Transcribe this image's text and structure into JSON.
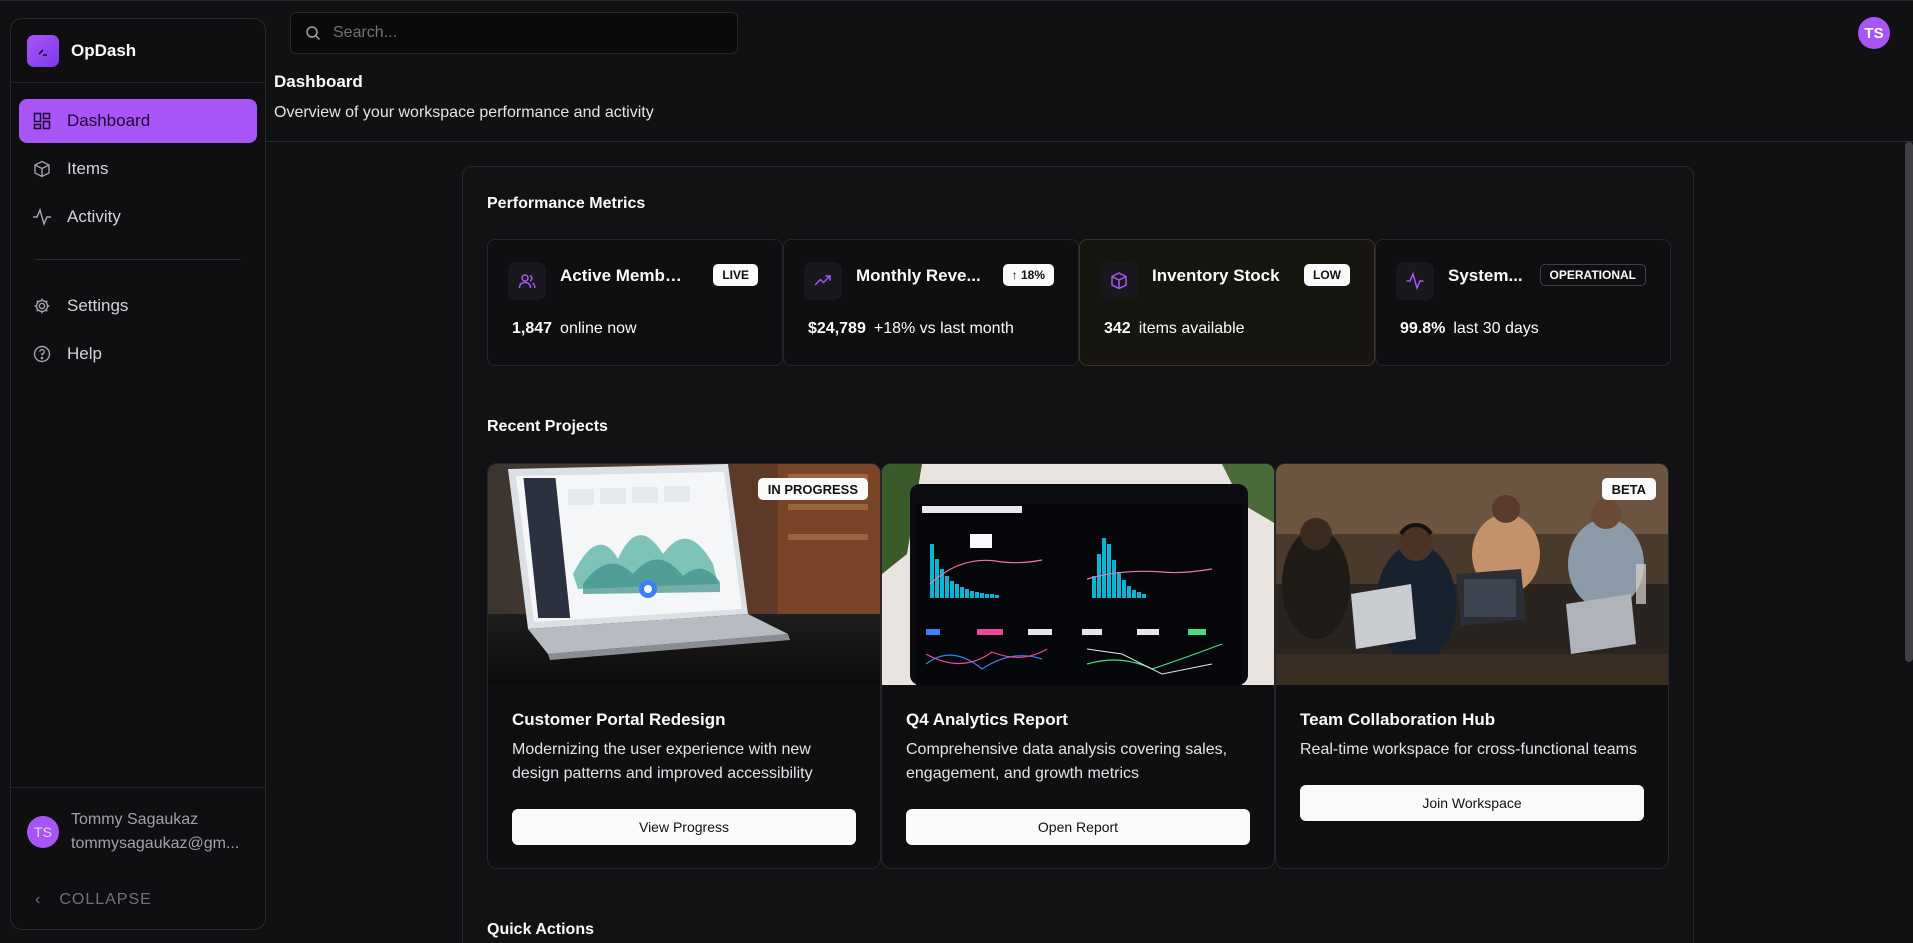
{
  "brand": {
    "name": "OpDash"
  },
  "nav": {
    "items": [
      {
        "label": "Dashboard",
        "icon": "dashboard-icon"
      },
      {
        "label": "Items",
        "icon": "box-icon"
      },
      {
        "label": "Activity",
        "icon": "activity-icon"
      }
    ],
    "secondary": [
      {
        "label": "Settings",
        "icon": "gear-icon"
      },
      {
        "label": "Help",
        "icon": "help-icon"
      }
    ],
    "collapse_label": "COLLAPSE"
  },
  "user": {
    "initials": "TS",
    "name": "Tommy Sagaukaz",
    "email": "tommysagaukaz@gm..."
  },
  "search": {
    "placeholder": "Search..."
  },
  "header": {
    "title": "Dashboard",
    "subtitle": "Overview of your workspace performance and activity"
  },
  "metrics": {
    "title": "Performance Metrics",
    "items": [
      {
        "title": "Active Members",
        "badge": "LIVE",
        "value": "1,847",
        "caption": "online now",
        "icon": "users-icon"
      },
      {
        "title": "Monthly Reve...",
        "badge": "↑ 18%",
        "value": "$24,789",
        "caption": "+18% vs last month",
        "icon": "trending-up-icon"
      },
      {
        "title": "Inventory Stock",
        "badge": "LOW",
        "value": "342",
        "caption": "items available",
        "icon": "box-icon"
      },
      {
        "title": "System...",
        "badge": "OPERATIONAL",
        "value": "99.8%",
        "caption": "last 30 days",
        "icon": "activity-icon"
      }
    ]
  },
  "projects": {
    "title": "Recent Projects",
    "items": [
      {
        "title": "Customer Portal Redesign",
        "badge": "IN PROGRESS",
        "description": "Modernizing the user experience with new design patterns and improved accessibility",
        "button": "View Progress"
      },
      {
        "title": "Q4 Analytics Report",
        "badge": "",
        "description": "Comprehensive data analysis covering sales, engagement, and growth metrics",
        "button": "Open Report"
      },
      {
        "title": "Team Collaboration Hub",
        "badge": "BETA",
        "description": "Real-time workspace for cross-functional teams",
        "button": "Join Workspace"
      }
    ]
  },
  "quick_actions": {
    "title": "Quick Actions"
  },
  "colors": {
    "accent": "#a855f7",
    "background": "#111113",
    "panel": "#121214",
    "warning_card": "#17150f"
  }
}
